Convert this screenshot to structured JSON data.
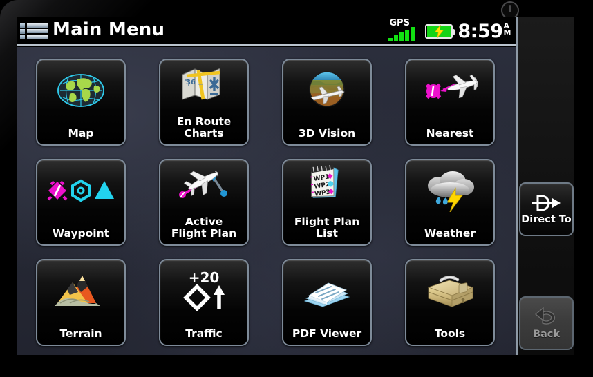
{
  "device": {
    "power_icon": "power-icon"
  },
  "header": {
    "menu_icon": "hamburger-list-icon",
    "title": "Main Menu"
  },
  "status": {
    "gps_label": "GPS",
    "gps_bars": 5,
    "gps_bar_heights": [
      5,
      9,
      13,
      17,
      21
    ],
    "gps_color": "#12e012",
    "battery_icon": "battery-charging-icon",
    "battery_level": 100,
    "battery_color": "#15d415",
    "bolt_color": "#ffe400",
    "time": "8:59",
    "am": "A",
    "pm": "M"
  },
  "menu": {
    "tiles": [
      {
        "id": "map",
        "label": "Map",
        "icon": "globe-icon"
      },
      {
        "id": "en-route-charts",
        "label": "En Route\nCharts",
        "icon": "folded-chart-icon"
      },
      {
        "id": "3d-vision",
        "label": "3D Vision",
        "icon": "terrain-aircraft-icon"
      },
      {
        "id": "nearest",
        "label": "Nearest",
        "icon": "aircraft-to-waypoint-icon"
      },
      {
        "id": "waypoint",
        "label": "Waypoint",
        "icon": "waypoint-symbols-icon"
      },
      {
        "id": "active-flight-plan",
        "label": "Active\nFlight Plan",
        "icon": "aircraft-route-icon"
      },
      {
        "id": "flight-plan-list",
        "label": "Flight Plan\nList",
        "icon": "notepad-waypoints-icon"
      },
      {
        "id": "weather",
        "label": "Weather",
        "icon": "cloud-lightning-rain-icon"
      },
      {
        "id": "terrain",
        "label": "Terrain",
        "icon": "mountain-icon"
      },
      {
        "id": "traffic",
        "label": "Traffic",
        "icon": "traffic-diamond-icon"
      },
      {
        "id": "pdf-viewer",
        "label": "PDF Viewer",
        "icon": "documents-icon"
      },
      {
        "id": "tools",
        "label": "Tools",
        "icon": "toolbox-icon"
      }
    ],
    "traffic_badge": "+20",
    "flight_plan_waypoints": [
      "WP1",
      "WP2",
      "WP3"
    ],
    "chart_number": "36"
  },
  "sidebar": {
    "direct_to": {
      "label": "Direct To",
      "icon": "direct-to-icon",
      "enabled": true
    },
    "back": {
      "label": "Back",
      "icon": "back-arrow-icon",
      "enabled": false
    }
  },
  "colors": {
    "accent_magenta": "#ee11cc",
    "accent_cyan": "#22d3ee",
    "green": "#a8d84a",
    "tile_border": "#7e8b99",
    "background": "#262935"
  }
}
